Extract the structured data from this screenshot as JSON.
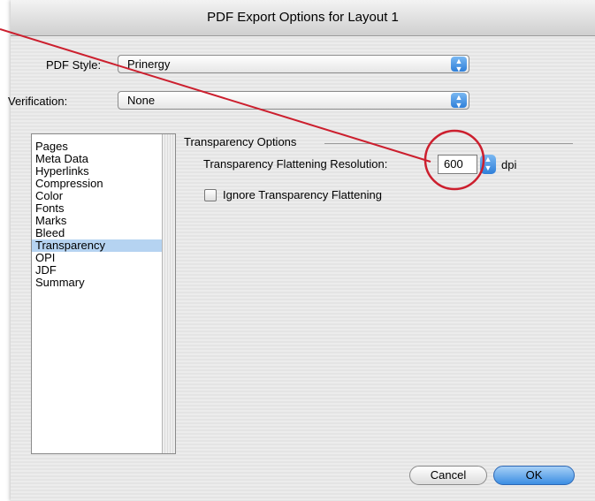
{
  "window": {
    "title": "PDF Export Options for Layout 1"
  },
  "pdf_style": {
    "label": "PDF Style:",
    "value": "Prinergy"
  },
  "verification": {
    "label": "Verification:",
    "value": "None"
  },
  "sidebar": {
    "items": [
      {
        "label": "Pages",
        "selected": false
      },
      {
        "label": "Meta Data",
        "selected": false
      },
      {
        "label": "Hyperlinks",
        "selected": false
      },
      {
        "label": "Compression",
        "selected": false
      },
      {
        "label": "Color",
        "selected": false
      },
      {
        "label": "Fonts",
        "selected": false
      },
      {
        "label": "Marks",
        "selected": false
      },
      {
        "label": "Bleed",
        "selected": false
      },
      {
        "label": "Transparency",
        "selected": true
      },
      {
        "label": "OPI",
        "selected": false
      },
      {
        "label": "JDF",
        "selected": false
      },
      {
        "label": "Summary",
        "selected": false
      }
    ]
  },
  "transparency": {
    "group_title": "Transparency Options",
    "resolution_label": "Transparency Flattening Resolution:",
    "resolution_value": "600",
    "resolution_unit": "dpi",
    "ignore_label": "Ignore Transparency Flattening",
    "ignore_checked": false
  },
  "buttons": {
    "cancel": "Cancel",
    "ok": "OK"
  },
  "colors": {
    "annotation": "#cc1f2e",
    "selection": "#b5d3f1",
    "accent": "#3b8de3"
  },
  "icons": {
    "popup_arrows": "updown-arrows-icon",
    "stepper": "stepper-arrows-icon"
  }
}
